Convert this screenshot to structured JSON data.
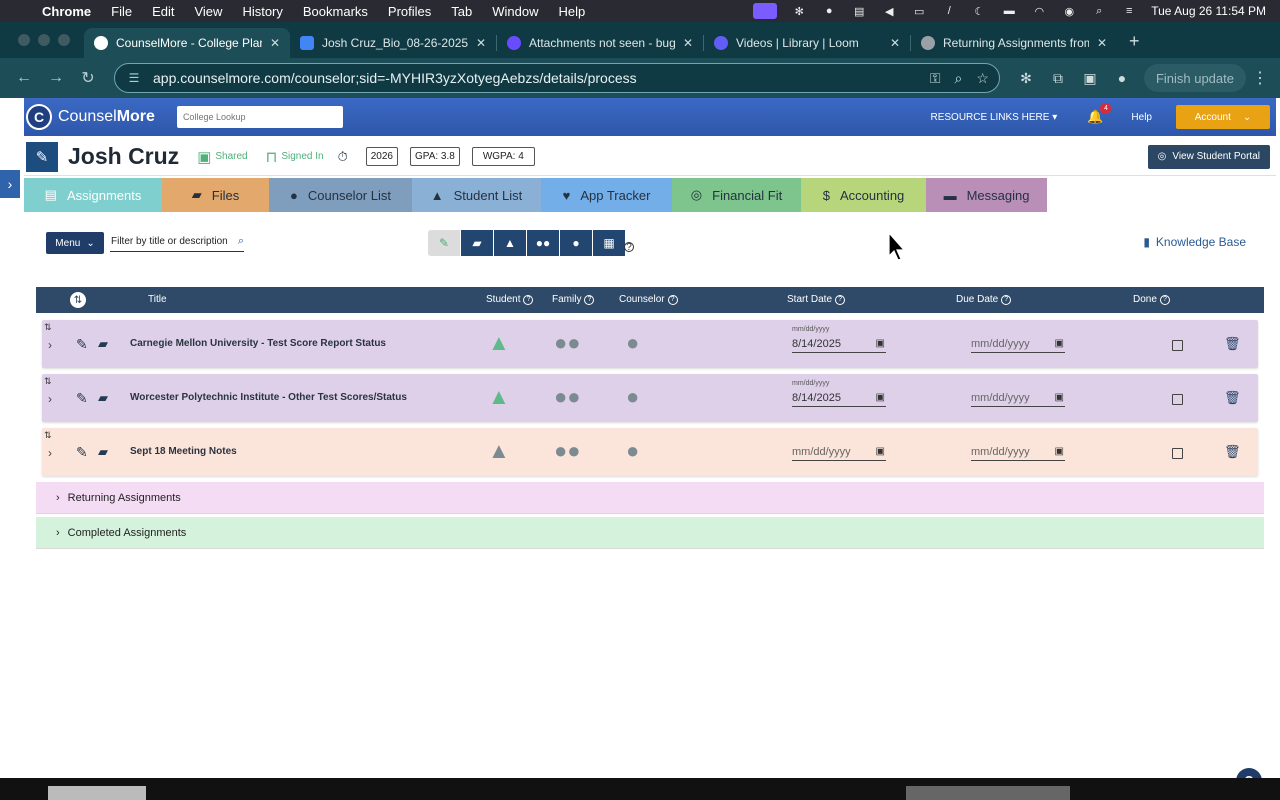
{
  "macbar": {
    "app": "Chrome",
    "menus": [
      "File",
      "Edit",
      "View",
      "History",
      "Bookmarks",
      "Profiles",
      "Tab",
      "Window",
      "Help"
    ],
    "clock": "Tue Aug 26  11:54 PM"
  },
  "browser": {
    "tabs": [
      {
        "title": "CounselMore - College Planni",
        "color": "#ffffff"
      },
      {
        "title": "Josh Cruz_Bio_08-26-2025.",
        "color": "#4285f4"
      },
      {
        "title": "Attachments not seen - bug r",
        "color": "#6a4cff"
      },
      {
        "title": "Videos | Library | Loom",
        "color": "#625df5"
      },
      {
        "title": "Returning Assignments from",
        "color": "#9aa0a6"
      }
    ],
    "url": "app.counselmore.com/counselor;sid=-MYHIR3yzXotyegAebzs/details/process",
    "finish_update": "Finish update"
  },
  "header": {
    "logo_part1": "Counsel",
    "logo_part2": "More",
    "lookup_placeholder": "College Lookup",
    "resource_links": "RESOURCE LINKS HERE",
    "notif_count": "4",
    "help": "Help",
    "account": "Account"
  },
  "student": {
    "name": "Josh Cruz",
    "shared": "Shared",
    "signed_in": "Signed In",
    "year": "2026",
    "gpa": "GPA: 3.8",
    "wgpa": "WGPA: 4",
    "portal_btn": "View Student Portal"
  },
  "nav_tabs": [
    {
      "label": "Assignments",
      "color": "#7fcfcf",
      "text": "#ffffff"
    },
    {
      "label": "Files",
      "color": "#e3a86c",
      "text": "#243141"
    },
    {
      "label": "Counselor List",
      "color": "#7f9dbd",
      "text": "#243141"
    },
    {
      "label": "Student List",
      "color": "#8bb0d6",
      "text": "#243141"
    },
    {
      "label": "App Tracker",
      "color": "#74aee8",
      "text": "#243141"
    },
    {
      "label": "Financial Fit",
      "color": "#7dc58c",
      "text": "#243141"
    },
    {
      "label": "Accounting",
      "color": "#b7d67c",
      "text": "#243141"
    },
    {
      "label": "Messaging",
      "color": "#b98fb8",
      "text": "#243141"
    }
  ],
  "toolbar": {
    "menu": "Menu",
    "filter_placeholder": "Filter by title or description",
    "knowledge_base": "Knowledge Base"
  },
  "columns": {
    "title": "Title",
    "student": "Student",
    "family": "Family",
    "counselor": "Counselor",
    "start_date": "Start Date",
    "due_date": "Due Date",
    "done": "Done"
  },
  "date_label": "mm/dd/yyyy",
  "rows": [
    {
      "title": "Carnegie Mellon University - Test Score Report Status",
      "start": "8/14/2025",
      "start_label": "mm/dd/yyyy",
      "due": "mm/dd/yyyy",
      "bg": "#ddd0e8",
      "student_color": "#5fb98b"
    },
    {
      "title": "Worcester Polytechnic Institute - Other Test Scores/Status",
      "start": "8/14/2025",
      "start_label": "mm/dd/yyyy",
      "due": "mm/dd/yyyy",
      "bg": "#ddd0e8",
      "student_color": "#5fb98b"
    },
    {
      "title": "Sept 18 Meeting Notes",
      "start": "mm/dd/yyyy",
      "start_label": "",
      "due": "mm/dd/yyyy",
      "bg": "#fbe4d9",
      "student_color": "#7c8a92"
    }
  ],
  "sections": {
    "returning": "Returning Assignments",
    "completed": "Completed Assignments"
  },
  "help_fab": "?"
}
